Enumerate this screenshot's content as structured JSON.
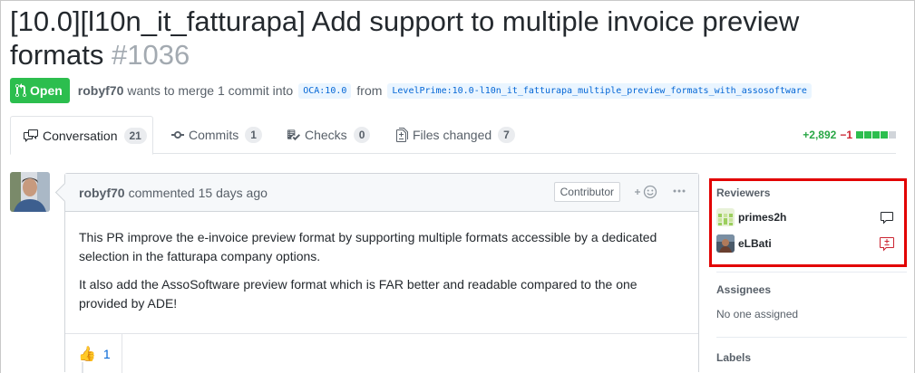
{
  "pr": {
    "title": "[10.0][l10n_it_fatturapa] Add support to multiple invoice preview formats",
    "number": "#1036",
    "state": "Open",
    "author": "robyf70",
    "merge_text": "wants to merge 1 commit into",
    "base_branch": "OCA:10.0",
    "from_text": "from",
    "head_branch": "LevelPrime:10.0-l10n_it_fatturapa_multiple_preview_formats_with_assosoftware"
  },
  "tabs": [
    {
      "label": "Conversation",
      "count": "21",
      "icon": "comment-discussion-icon"
    },
    {
      "label": "Commits",
      "count": "1",
      "icon": "git-commit-icon"
    },
    {
      "label": "Checks",
      "count": "0",
      "icon": "checklist-icon"
    },
    {
      "label": "Files changed",
      "count": "7",
      "icon": "file-diff-icon"
    }
  ],
  "diffstat": {
    "additions": "+2,892",
    "deletions": "−1",
    "colors": {
      "add": "#2cbe4e",
      "neutral": "#d1d5da"
    }
  },
  "comment": {
    "author": "robyf70",
    "action": "commented 15 days ago",
    "role": "Contributor",
    "paragraphs": [
      "This PR improve the e-invoice preview format by supporting multiple formats accessible by a dedicated selection in the fatturapa company options.",
      "It also add the AssoSoftware preview format which is FAR better and readable compared to the one provided by ADE!"
    ],
    "reactions": [
      {
        "emoji": "👍",
        "count": "1"
      }
    ]
  },
  "sidebar": {
    "reviewers_heading": "Reviewers",
    "reviewers": [
      {
        "name": "primes2h",
        "status_icon": "comment-icon"
      },
      {
        "name": "eLBati",
        "status_icon": "request-changes-icon"
      }
    ],
    "assignees_heading": "Assignees",
    "assignees_value": "No one assigned",
    "labels_heading": "Labels"
  },
  "colors": {
    "open_green": "#2cbe4e",
    "link_blue": "#0366d6",
    "highlight_red": "#e20000"
  }
}
